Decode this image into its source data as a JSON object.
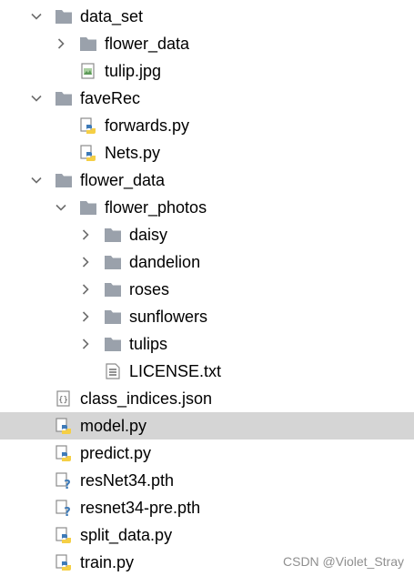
{
  "project_tree": {
    "items": [
      {
        "label": "data_set",
        "type": "folder",
        "expanded": true
      },
      {
        "label": "flower_data",
        "type": "folder",
        "expanded": false
      },
      {
        "label": "tulip.jpg",
        "type": "image-file"
      },
      {
        "label": "faveRec",
        "type": "folder",
        "expanded": true
      },
      {
        "label": "forwards.py",
        "type": "python-file"
      },
      {
        "label": "Nets.py",
        "type": "python-file"
      },
      {
        "label": "flower_data",
        "type": "folder",
        "expanded": true
      },
      {
        "label": "flower_photos",
        "type": "folder",
        "expanded": true
      },
      {
        "label": "daisy",
        "type": "folder",
        "expanded": false
      },
      {
        "label": "dandelion",
        "type": "folder",
        "expanded": false
      },
      {
        "label": "roses",
        "type": "folder",
        "expanded": false
      },
      {
        "label": "sunflowers",
        "type": "folder",
        "expanded": false
      },
      {
        "label": "tulips",
        "type": "folder",
        "expanded": false
      },
      {
        "label": "LICENSE.txt",
        "type": "text-file"
      },
      {
        "label": "class_indices.json",
        "type": "json-file"
      },
      {
        "label": "model.py",
        "type": "python-file",
        "selected": true
      },
      {
        "label": "predict.py",
        "type": "python-file"
      },
      {
        "label": "resNet34.pth",
        "type": "unknown-file"
      },
      {
        "label": "resnet34-pre.pth",
        "type": "unknown-file"
      },
      {
        "label": "split_data.py",
        "type": "python-file"
      },
      {
        "label": "train.py",
        "type": "python-file"
      }
    ]
  },
  "watermark": "CSDN @Violet_Stray",
  "colors": {
    "selection": "#d5d5d5",
    "folder": "#9aa1ab",
    "chevron": "#6e6e6e",
    "python_blue": "#3d7ab8",
    "python_yellow": "#f5cf45",
    "file_outline": "#8c8c8c"
  }
}
